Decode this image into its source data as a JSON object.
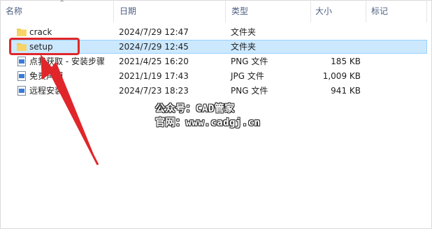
{
  "columns": {
    "name": "名称",
    "date": "日期",
    "type": "类型",
    "size": "大小",
    "tags": "标记"
  },
  "files": [
    {
      "name": "crack",
      "date": "2024/7/29 12:47",
      "type": "文件夹",
      "size": "",
      "icon": "folder-icon",
      "selected": false
    },
    {
      "name": "setup",
      "date": "2024/7/29 12:45",
      "type": "文件夹",
      "size": "",
      "icon": "folder-icon",
      "selected": true
    },
    {
      "name": "点我获取 - 安装步骤",
      "date": "2021/4/25 16:20",
      "type": "PNG 文件",
      "size": "185 KB",
      "icon": "image-file-icon",
      "selected": false
    },
    {
      "name": "免责声明",
      "date": "2021/1/19 17:43",
      "type": "JPG 文件",
      "size": "1,009 KB",
      "icon": "image-file-icon",
      "selected": false
    },
    {
      "name": "远程安装",
      "date": "2024/7/23 18:23",
      "type": "PNG 文件",
      "size": "941 KB",
      "icon": "image-file-icon",
      "selected": false
    }
  ],
  "watermark": {
    "line1": "公众号：CAD管家",
    "line2": "官网：www.cadgj.cn"
  },
  "colors": {
    "selection_fill": "#cce8ff",
    "selection_border": "#99d1ff",
    "annotation_red": "#e0262a",
    "folder_yellow": "#f2c94c"
  }
}
